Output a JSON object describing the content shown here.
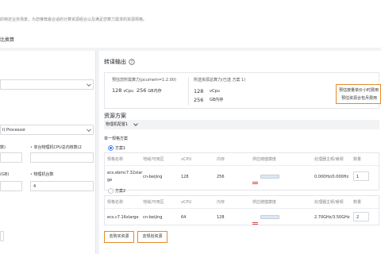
{
  "intro": "的特定业务场景，为您推荐最合适的计算资源组合以及满足您算力需求的资源规格。",
  "tab": "比换算",
  "left": {
    "field2": "I) Processor",
    "label_a": "数)",
    "label_b": "单台物理机CPU总内核数(2",
    "label_c": "(GB)",
    "label_d": "物理机台数",
    "value_d": "4"
  },
  "right": {
    "title": "转译输出",
    "summary": {
      "col1_label": "预估您所需算力(pcumem=1:2.00)",
      "col1_cpu": "128",
      "col1_cpu_unit": "vCpu",
      "col1_mem": "256",
      "col1_mem_unit": "GB内存",
      "col2_label": "所选资源总算力(已选 方案 1)",
      "col2_cpu": "128",
      "col2_cpu_unit": "vCpu",
      "col2_mem": "256",
      "col2_mem_unit": "GB内存",
      "note1": "预估按量单价小时费用",
      "note2": "预估资源合包月费用"
    },
    "resource_title": "资源方案",
    "plan_dropdown": "物理机配置1",
    "single_group_label": "单一规格方案",
    "plan1_label": "方案1",
    "plan2_label": "方案2",
    "columns": [
      "规格名称",
      "地域/可用区",
      "vCPU",
      "内存",
      "供应链健康度",
      "处理器主频/睿频",
      "数量"
    ],
    "rows": [
      {
        "name_line1": "ecs.ebmc7.32xlar",
        "name_line2": "ge",
        "region": "cn-beijing",
        "vcpu": "128",
        "mem": "256",
        "freq": "0.000Hz/0.000Hz",
        "qty": "1"
      },
      {
        "name_line1": "ecs.c7.16xlarge",
        "name_line2": "",
        "region": "cn-beijing",
        "vcpu": "64",
        "mem": "128",
        "freq": "2.70GHz/3.50GHz",
        "qty": "2"
      }
    ],
    "btn_buy": "去购买资源",
    "btn_plan": "去规划资源"
  },
  "colors": {
    "accent_orange": "#e58a2b",
    "radio_blue": "#3370ff",
    "flag_red": "#d94040"
  }
}
